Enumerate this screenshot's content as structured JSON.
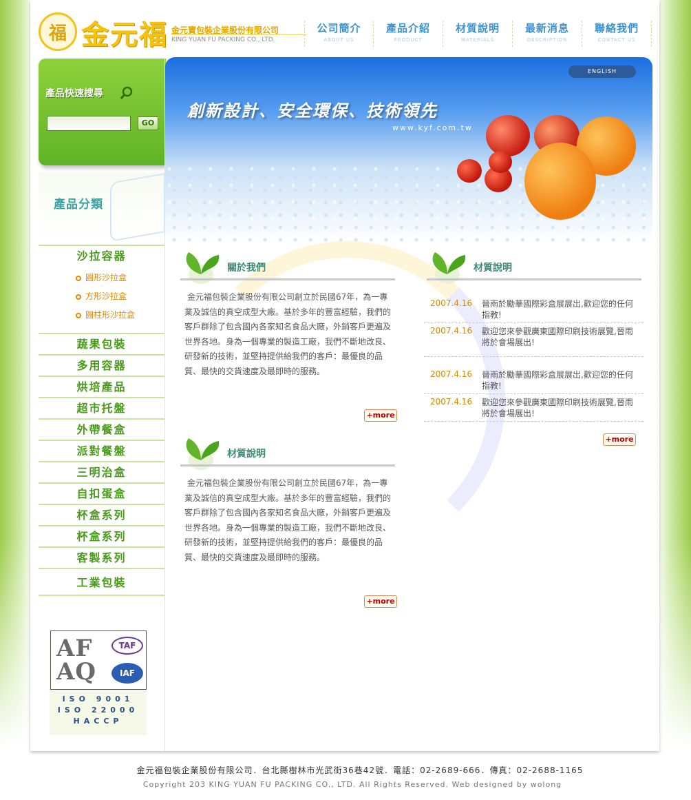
{
  "header": {
    "logo_text": "金元福",
    "company_cn": "金元寶包裝企業股份有限公司",
    "company_en": "KING YUAN FU PACKING CO., LTD."
  },
  "nav": [
    {
      "zh": "公司簡介",
      "en": "ABOUT US"
    },
    {
      "zh": "產品介紹",
      "en": "PRODUCT"
    },
    {
      "zh": "材質說明",
      "en": "MATERIALS"
    },
    {
      "zh": "最新消息",
      "en": "DESCRIPTION"
    },
    {
      "zh": "聯絡我們",
      "en": "CONTACT US"
    }
  ],
  "search": {
    "title": "產品快速搜尋",
    "input_value": "",
    "go_label": "GO"
  },
  "categories": {
    "heading": "產品分類",
    "first": "沙拉容器",
    "subitems": [
      "圓形沙拉盒",
      "方形沙拉盒",
      "圓柱形沙拉盒"
    ],
    "items": [
      "蔬果包裝",
      "多用容器",
      "烘培產品",
      "超市托盤",
      "外帶餐盒",
      "派對餐盤",
      "三明治盒",
      "自扣蛋盒",
      "杯盒系列",
      "杯盒系列",
      "客製系列",
      "工業包裝"
    ]
  },
  "certification": {
    "afaq_line1": "AF",
    "afaq_line2": "AQ",
    "taf": "TAF",
    "iaf": "IAF",
    "lines": [
      "ISO 9001",
      "ISO 22000",
      "HACCP"
    ]
  },
  "banner": {
    "english_label": "ENGLISH",
    "slogan": "創新設計、安全環保、技術領先",
    "url": "www.kyf.com.tw"
  },
  "about": {
    "title": "關於我們",
    "body": "金元福包裝企業股份有限公司創立於民國67年，為一專業及誠信的真空成型大廠。基於多年的豐富經驗，我們的客戶群除了包含國內各家知名食品大廠，外銷客戶更遍及世界各地。身為一個專業的製造工廠，我們不斷地改良、研發新的技術，並堅持提供給我們的客戶：最優良的品質、最快的交貨速度及最即時的服務。",
    "more": "+more"
  },
  "materials": {
    "title": "材質說明",
    "body": "金元福包裝企業股份有限公司創立於民國67年，為一專業及誠信的真空成型大廠。基於多年的豐富經驗，我們的客戶群除了包含國內各家知名食品大廠，外銷客戶更遍及世界各地。身為一個專業的製造工廠，我們不斷地改良、研發新的技術，並堅持提供給我們的客戶：最優良的品質、最快的交貨速度及最即時的服務。",
    "more": "+more"
  },
  "news": {
    "title": "材質說明",
    "items": [
      {
        "date": "2007.4.16",
        "text": "晉雨於勵華國際彩盒展展出,歡迎您的任何指教!"
      },
      {
        "date": "2007.4.16",
        "text": "歡迎您來參觀廣東國際印刷技術展覽,晉雨將於會場展出!"
      },
      {
        "date": "2007.4.16",
        "text": "晉雨於勵華國際彩盒展展出,歡迎您的任何指教!"
      },
      {
        "date": "2007.4.16",
        "text": "歡迎您來參觀廣東國際印刷技術展覽,晉雨將於會場展出!"
      }
    ],
    "more": "+more"
  },
  "footer": {
    "address": "金元福包裝企業股份有限公司．台北縣樹林市光武街36巷42號．電話：02-2689-666．傳真：02-2688-1165",
    "copyright": "Copyright 203 KING YUAN FU PACKING CO., LTD. All Rights Reserved. Web designed by wolong"
  },
  "colors": {
    "brand_green": "#5fb327",
    "brand_gold": "#f5c20e",
    "nav_blue": "#3b93d1",
    "date_orange": "#d68a00",
    "more_red": "#c00000"
  }
}
